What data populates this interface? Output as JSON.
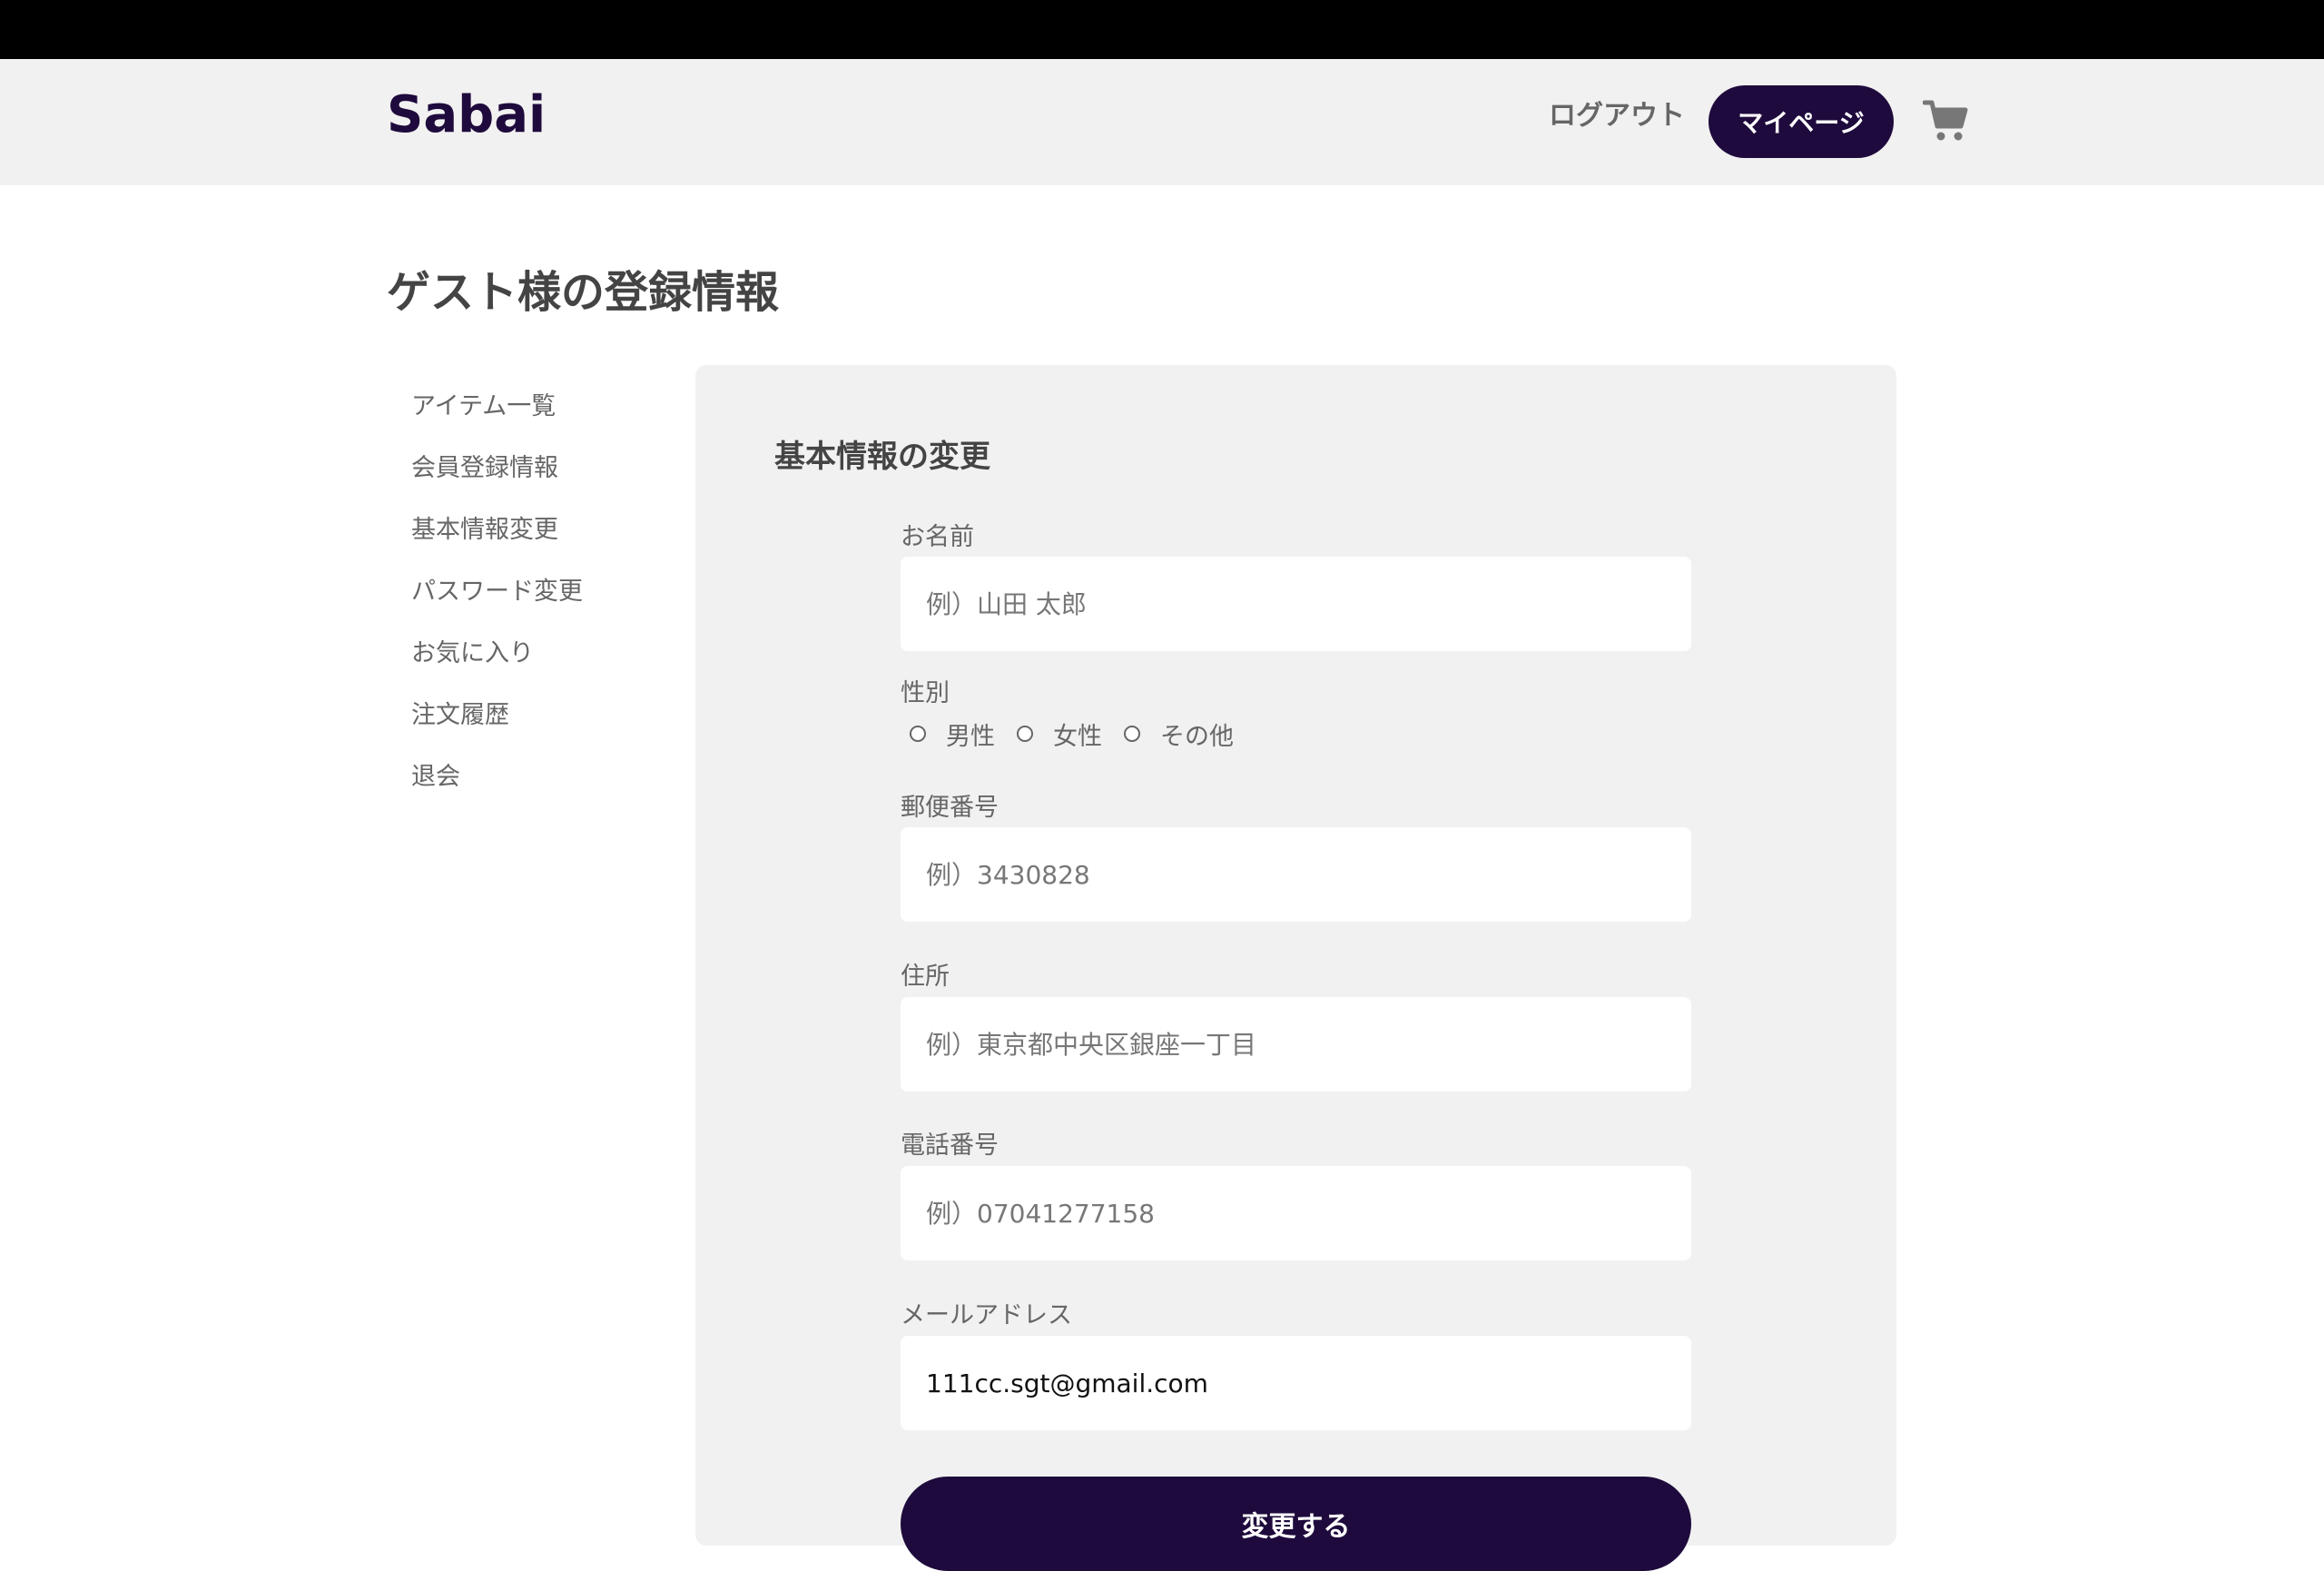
{
  "header": {
    "logo": "Sabai",
    "logout_label": "ログアウト",
    "mypage_label": "マイページ",
    "cart_icon": "cart-icon"
  },
  "page": {
    "title": "ゲスト様の登録情報"
  },
  "sidebar": {
    "items": [
      {
        "label": "アイテム一覧"
      },
      {
        "label": "会員登録情報"
      },
      {
        "label": "基本情報変更"
      },
      {
        "label": "パスワード変更"
      },
      {
        "label": "お気に入り"
      },
      {
        "label": "注文履歴"
      },
      {
        "label": "退会"
      }
    ]
  },
  "form": {
    "title": "基本情報の変更",
    "name": {
      "label": "お名前",
      "placeholder": "例）山田 太郎",
      "value": ""
    },
    "gender": {
      "label": "性別",
      "options": [
        "男性",
        "女性",
        "その他"
      ]
    },
    "postal": {
      "label": "郵便番号",
      "placeholder": "例）3430828",
      "value": ""
    },
    "address": {
      "label": "住所",
      "placeholder": "例）東京都中央区銀座一丁目",
      "value": ""
    },
    "phone": {
      "label": "電話番号",
      "placeholder": "例）07041277158",
      "value": ""
    },
    "email": {
      "label": "メールアドレス",
      "placeholder": "",
      "value": "111cc.sgt@gmail.com"
    },
    "submit_label": "変更する"
  },
  "colors": {
    "brand": "#1e0a3c",
    "header_bg": "#f1f1f1",
    "panel_bg": "#f1f1f1"
  }
}
